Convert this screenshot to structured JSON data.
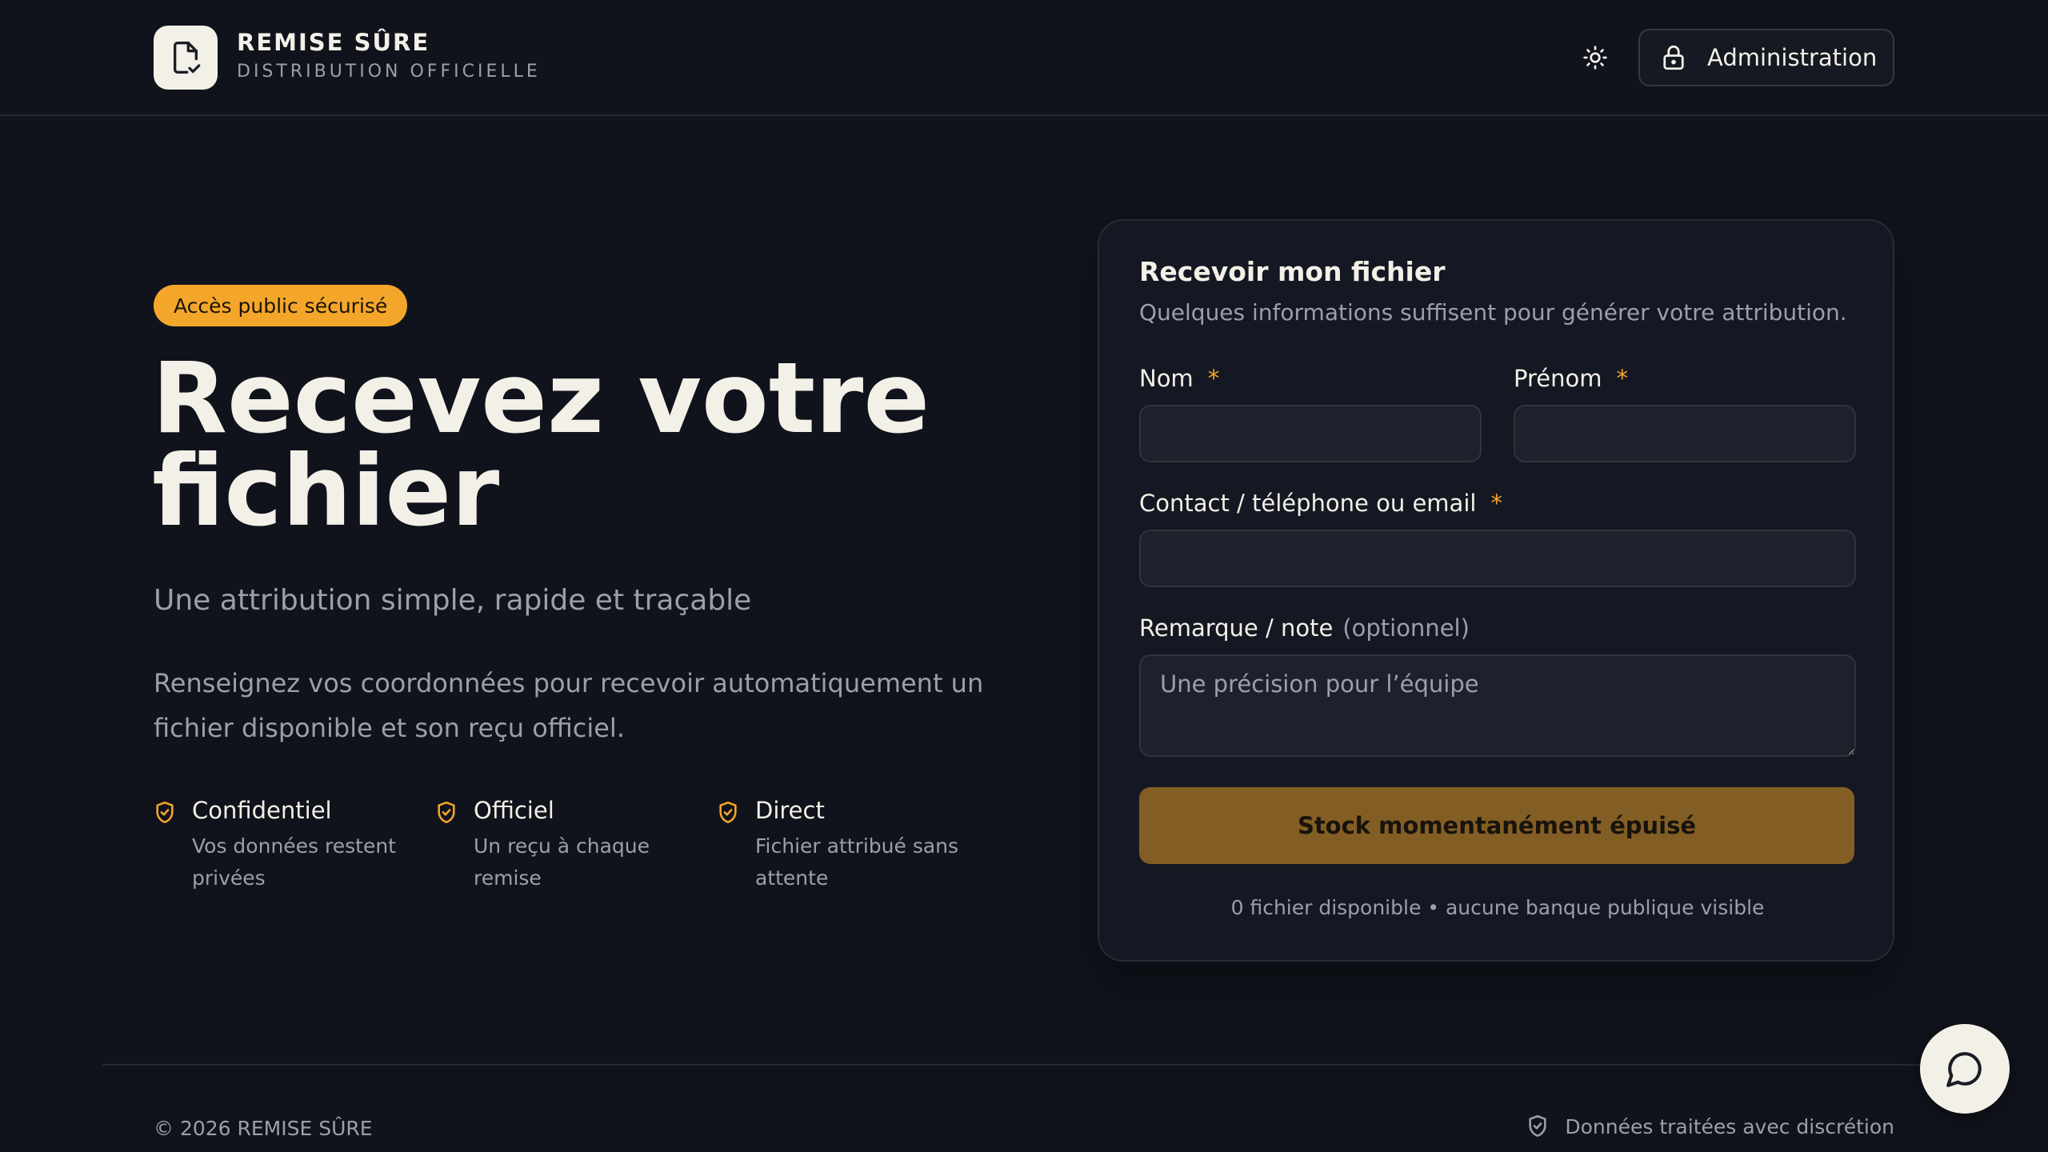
{
  "header": {
    "brand_name": "REMISE SÛRE",
    "brand_sub": "DISTRIBUTION OFFICIELLE",
    "theme_icon": "sun-icon",
    "admin_label": "Administration",
    "admin_icon": "lock-icon"
  },
  "hero": {
    "badge": "Accès public sécurisé",
    "title": "Recevez votre fichier",
    "subtitle": "Une attribution simple, rapide et traçable",
    "description": "Renseignez vos coordonnées pour recevoir automatiquement un fichier disponible et son reçu officiel.",
    "features": [
      {
        "icon": "shield-check-icon",
        "title": "Confidentiel",
        "desc": "Vos données restent privées"
      },
      {
        "icon": "shield-check-icon",
        "title": "Officiel",
        "desc": "Un reçu à chaque remise"
      },
      {
        "icon": "shield-check-icon",
        "title": "Direct",
        "desc": "Fichier attribué sans attente"
      }
    ]
  },
  "form": {
    "title": "Recevoir mon fichier",
    "subtitle": "Quelques informations suffisent pour générer votre attribution.",
    "nom_label": "Nom",
    "prenom_label": "Prénom",
    "contact_label": "Contact / téléphone ou email",
    "required_mark": "*",
    "note_label": "Remarque / note",
    "note_optional": "(optionnel)",
    "note_placeholder": "Une précision pour l’équipe",
    "nom_value": "",
    "prenom_value": "",
    "contact_value": "",
    "submit_label": "Stock momentanément épuisé",
    "stock_note": "0 fichier disponible • aucune banque publique visible"
  },
  "footer": {
    "copyright": "© 2026 REMISE SÛRE",
    "privacy": "Données traitées avec discrétion",
    "privacy_icon": "shield-check-icon"
  },
  "chat": {
    "icon": "chat-bubble-icon"
  },
  "colors": {
    "background": "#10131b",
    "accent": "#f4a62a",
    "button_disabled": "#835e24",
    "text_primary": "#f3f0e8",
    "text_muted": "#9aa0ab"
  }
}
